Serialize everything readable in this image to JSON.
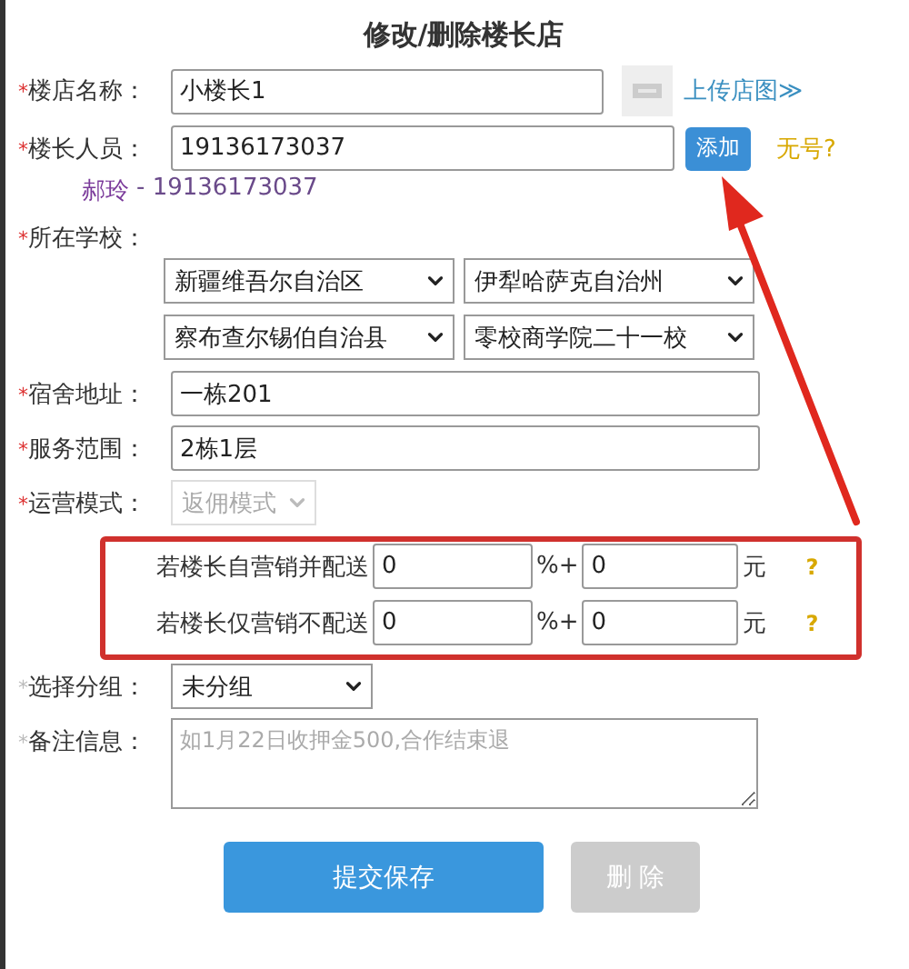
{
  "title": "修改/删除楼长店",
  "shop_name": {
    "mark": "*",
    "label": "楼店名称：",
    "required": true,
    "value": "小楼长1",
    "upload_link": "上传店图≫"
  },
  "manager": {
    "mark": "*",
    "label": "楼长人员：",
    "required": true,
    "value": "19136173037",
    "add_button": "添加",
    "no_number_link": "无号?",
    "person_name": "郝玲",
    "person_phone": "- 19136173037"
  },
  "school": {
    "mark": "*",
    "label": "所在学校：",
    "required": true,
    "selects": [
      "新疆维吾尔自治区",
      "伊犁哈萨克自治州",
      "察布查尔锡伯自治县",
      "零校商学院二十一校"
    ]
  },
  "dorm_address": {
    "mark": "*",
    "label": "宿舍地址：",
    "required": true,
    "value": "一栋201"
  },
  "service_range": {
    "mark": "*",
    "label": "服务范围：",
    "required": true,
    "value": "2栋1层"
  },
  "mode": {
    "mark": "*",
    "label": "运营模式：",
    "required": true,
    "value": "返佣模式",
    "disabled": true
  },
  "commission_rows": [
    {
      "label": "若楼长自营销并配送",
      "percent": "0",
      "percent_unit": "%+",
      "amount": "0",
      "unit": "元",
      "help": "?"
    },
    {
      "label": "若楼长仅营销不配送",
      "percent": "0",
      "percent_unit": "%+",
      "amount": "0",
      "unit": "元",
      "help": "?"
    }
  ],
  "group": {
    "mark": "*",
    "label": "选择分组：",
    "required": false,
    "value": "未分组"
  },
  "notes": {
    "mark": "*",
    "label": "备注信息：",
    "required": false,
    "placeholder": "如1月22日收押金500,合作结束退"
  },
  "buttons": [
    {
      "label": "提交保存",
      "kind": "primary",
      "disabled": false
    },
    {
      "label": "删 除",
      "kind": "secondary",
      "disabled": true
    }
  ]
}
